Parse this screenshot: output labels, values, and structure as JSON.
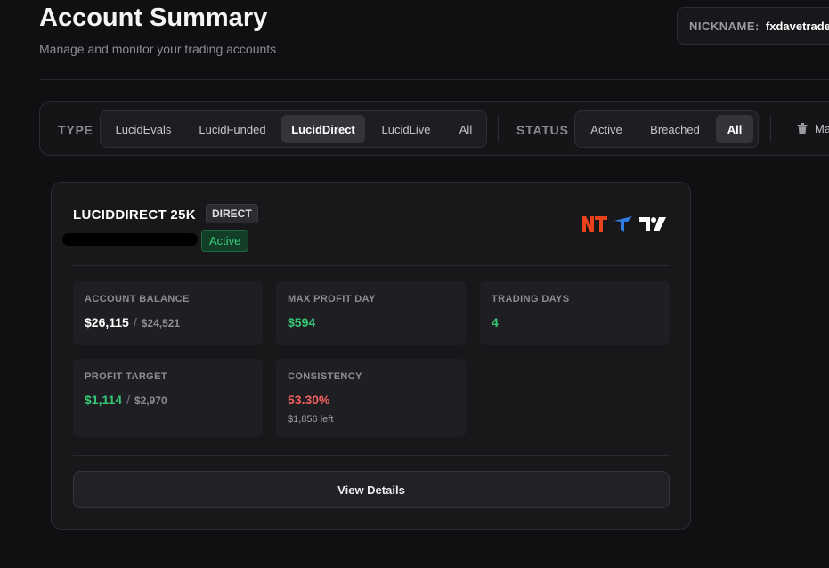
{
  "header": {
    "title": "Account Summary",
    "subtitle": "Manage and monitor your trading accounts",
    "nickname_label": "NICKNAME:",
    "nickname_value": "fxdavetrader"
  },
  "filters": {
    "type_label": "TYPE",
    "type_options": [
      "LucidEvals",
      "LucidFunded",
      "LucidDirect",
      "LucidLive",
      "All"
    ],
    "type_selected": "LucidDirect",
    "status_label": "STATUS",
    "status_options": [
      "Active",
      "Breached",
      "All"
    ],
    "status_selected": "All",
    "manage_label": "Ma",
    "manage_icon": "trash-icon"
  },
  "account": {
    "name": "LUCIDDIRECT 25K",
    "type_badge": "DIRECT",
    "status": "Active",
    "platforms": [
      "ninjatrader-logo",
      "tradovate-logo",
      "tradingview-logo"
    ],
    "stats": {
      "balance": {
        "label": "ACCOUNT BALANCE",
        "value": "$26,115",
        "sub": "$24,521"
      },
      "max_profit_day": {
        "label": "MAX PROFIT DAY",
        "value": "$594"
      },
      "trading_days": {
        "label": "TRADING DAYS",
        "value": "4"
      },
      "profit_target": {
        "label": "PROFIT TARGET",
        "value": "$1,114",
        "sub": "$2,970"
      },
      "consistency": {
        "label": "CONSISTENCY",
        "value": "53.30%",
        "note": "$1,856 left"
      }
    },
    "view_button": "View Details"
  },
  "colors": {
    "background": "#101013",
    "card": "#18181b",
    "positive": "#36c776",
    "negative": "#f0605f",
    "ninjatrader": "#e8431c",
    "tradovate": "#2f7de1"
  }
}
